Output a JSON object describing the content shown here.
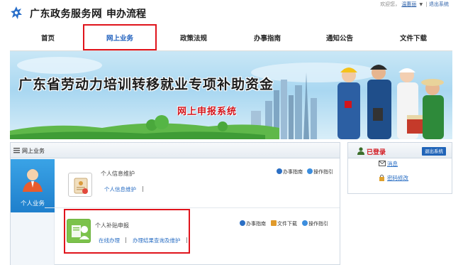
{
  "header": {
    "site_title": "广东政务服务网",
    "page_subtitle": "申办流程",
    "welcome": "欢迎您，",
    "username": "温惠丽",
    "logout": "退出系统"
  },
  "nav": {
    "items": [
      {
        "label": "首页"
      },
      {
        "label": "网上业务",
        "active": true
      },
      {
        "label": "政策法规"
      },
      {
        "label": "办事指南"
      },
      {
        "label": "通知公告"
      },
      {
        "label": "文件下载"
      }
    ]
  },
  "banner": {
    "title": "广东省劳动力培训转移就业专项补助资金",
    "subtitle": "网上申报系统"
  },
  "panel": {
    "header": "网上业务",
    "tab_label": "个人业务",
    "services": [
      {
        "title": "个人信息维护",
        "links": [
          "个人信息维护"
        ],
        "actions": [
          "办事指南",
          "操作指引"
        ]
      },
      {
        "title": "个人补贴申报",
        "links": [
          "在线办理",
          "办理结果查询及维护"
        ],
        "actions": [
          "办事指南",
          "文件下载",
          "操作指引"
        ]
      }
    ]
  },
  "user_panel": {
    "status": "已登录",
    "logout_button": "退出系统",
    "links": [
      "消息",
      "密码修改"
    ]
  },
  "colors": {
    "accent_blue": "#1e5fbd",
    "highlight_red": "#e0141c",
    "link_blue": "#2b6fc4"
  }
}
